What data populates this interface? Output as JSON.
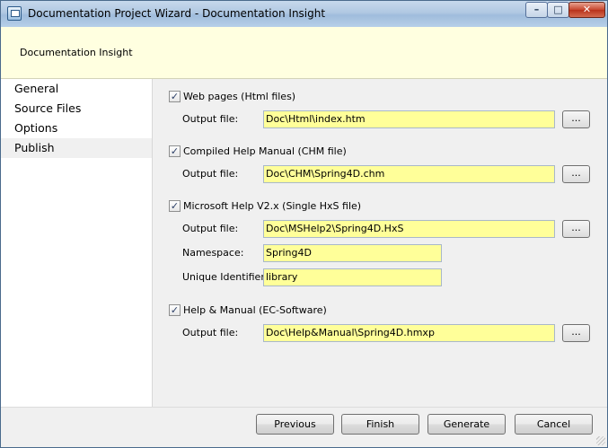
{
  "window": {
    "title": "Documentation Project Wizard - Documentation Insight",
    "controls": {
      "minimize": "–",
      "maximize": "□",
      "close": "✕"
    }
  },
  "banner": {
    "title": "Documentation Insight"
  },
  "nav": {
    "items": [
      {
        "label": "General"
      },
      {
        "label": "Source Files"
      },
      {
        "label": "Options"
      },
      {
        "label": "Publish",
        "selected": true
      }
    ]
  },
  "publish": {
    "web": {
      "checked": true,
      "label": "Web pages (Html files)",
      "output_label": "Output file:",
      "output_value": "Doc\\Html\\index.htm"
    },
    "chm": {
      "checked": true,
      "label": "Compiled Help Manual (CHM file)",
      "output_label": "Output file:",
      "output_value": "Doc\\CHM\\Spring4D.chm"
    },
    "mshelp": {
      "checked": true,
      "label": "Microsoft Help V2.x (Single HxS file)",
      "output_label": "Output file:",
      "output_value": "Doc\\MSHelp2\\Spring4D.HxS",
      "namespace_label": "Namespace:",
      "namespace_value": "Spring4D",
      "uid_label": "Unique Identifier:",
      "uid_value": "library"
    },
    "helpmanual": {
      "checked": true,
      "label": "Help & Manual (EC-Software)",
      "output_label": "Output file:",
      "output_value": "Doc\\Help&Manual\\Spring4D.hmxp"
    },
    "browse_label": "...",
    "check_mark": "✓"
  },
  "footer": {
    "previous": "Previous",
    "finish": "Finish",
    "generate": "Generate",
    "cancel": "Cancel"
  },
  "colors": {
    "field_bg": "#ffff99",
    "banner_bg": "#ffffe0",
    "selection_bg": "#f0f0f0"
  }
}
